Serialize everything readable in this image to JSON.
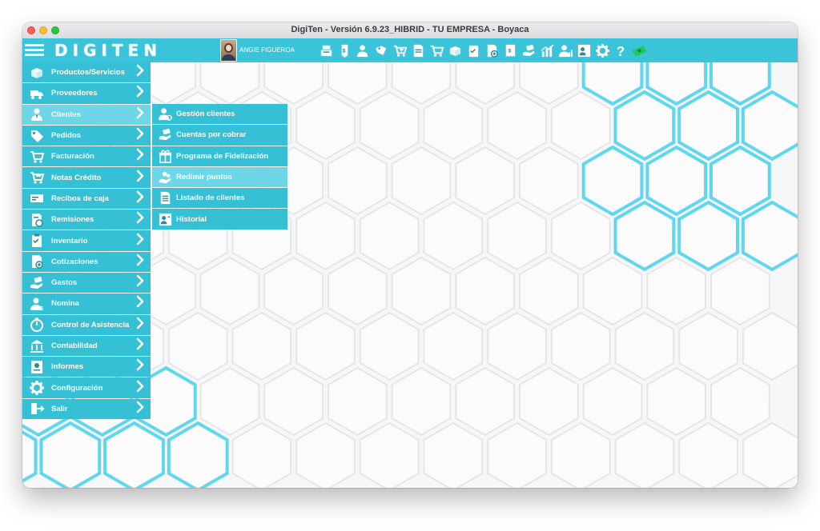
{
  "window": {
    "title": "DigiTen - Versión 6.9.23_HIBRID  -  TU EMPRESA - Boyaca"
  },
  "toolbar": {
    "logo_text": "DIGITEN",
    "user_name": "ANGIE FIGUEROA",
    "accent_color": "#3bc4d9",
    "icons": [
      "cash-register-icon",
      "tag-dollar-icon",
      "user-tie-icon",
      "box-tag-icon",
      "cart-add-icon",
      "document-icon",
      "cart-icon",
      "box-icon",
      "clipboard-check-icon",
      "document-plus-icon",
      "receipt-icon",
      "hand-money-icon",
      "bar-chart-icon",
      "user-chart-icon",
      "id-card-icon",
      "gear-icon",
      "help-icon",
      "money-icon"
    ]
  },
  "menu": {
    "items": [
      {
        "label": "Productos/Servicios",
        "icon": "box-icon"
      },
      {
        "label": "Proveedores",
        "icon": "truck-icon"
      },
      {
        "label": "Clientes",
        "icon": "client-icon"
      },
      {
        "label": "Pedidos",
        "icon": "tags-icon"
      },
      {
        "label": "Facturación",
        "icon": "cart-icon"
      },
      {
        "label": "Notas Crédito",
        "icon": "cart-minus-icon"
      },
      {
        "label": "Recibos de caja",
        "icon": "receipt-box-icon"
      },
      {
        "label": "Remisiones",
        "icon": "document-refresh-icon"
      },
      {
        "label": "Inventario",
        "icon": "clipboard-icon"
      },
      {
        "label": "Cotizaciones",
        "icon": "document-plus-icon"
      },
      {
        "label": "Gastos",
        "icon": "hand-money-icon"
      },
      {
        "label": "Nomina",
        "icon": "user-dollar-icon"
      },
      {
        "label": "Control de Asistencia",
        "icon": "stopwatch-icon"
      },
      {
        "label": "Contabilidad",
        "icon": "bank-icon"
      },
      {
        "label": "Informes",
        "icon": "report-icon"
      },
      {
        "label": "Configuración",
        "icon": "gear-icon"
      },
      {
        "label": "Salir",
        "icon": "exit-icon"
      }
    ],
    "active_item": "Clientes"
  },
  "submenu": {
    "items": [
      {
        "label": "Gestión clientes",
        "icon": "user-gear-icon"
      },
      {
        "label": "Cuentas por cobrar",
        "icon": "hand-money-icon"
      },
      {
        "label": "Programa de Fidelización",
        "icon": "gift-icon"
      },
      {
        "label": "Redimir puntos",
        "icon": "hand-coins-icon"
      },
      {
        "label": "Listado de clientes",
        "icon": "list-document-icon"
      },
      {
        "label": "Historial",
        "icon": "history-icon"
      }
    ],
    "hovered_item": "Redimir puntos"
  }
}
